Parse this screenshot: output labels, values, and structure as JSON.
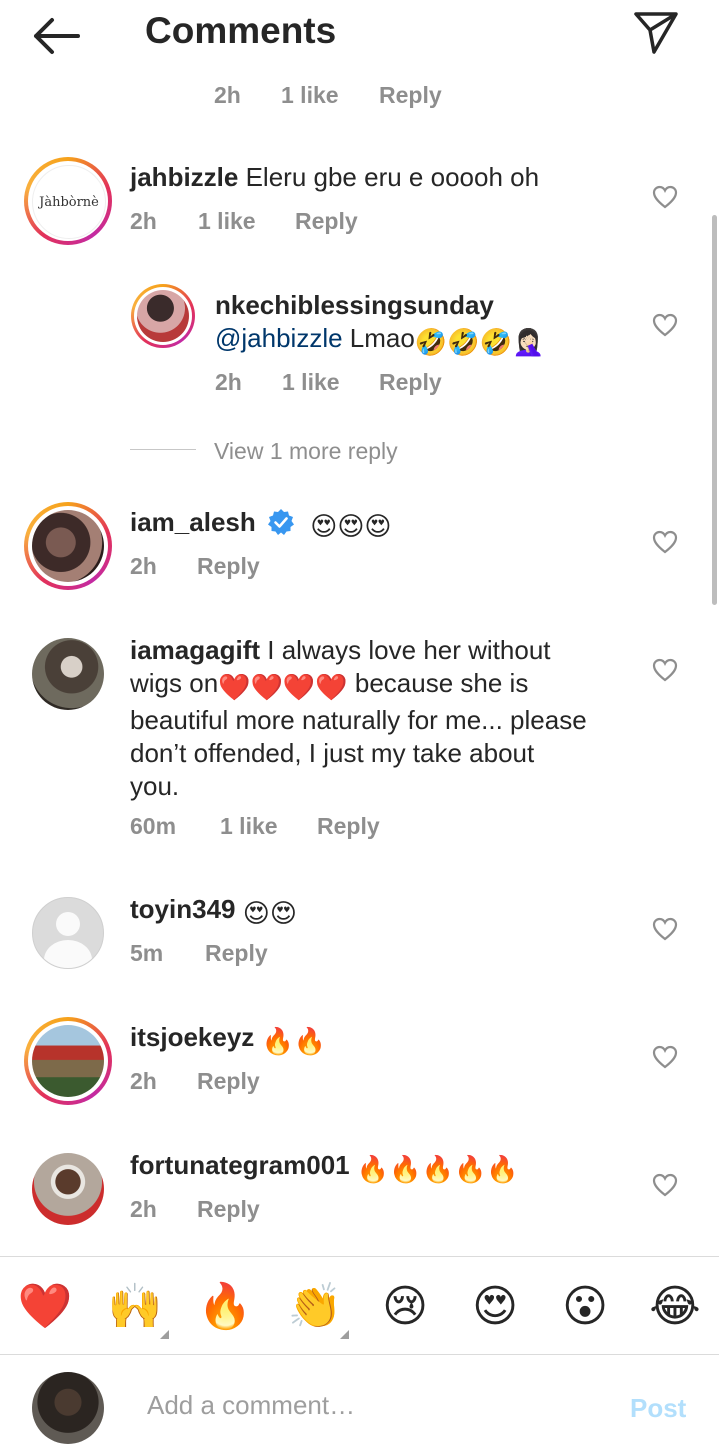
{
  "header": {
    "title": "Comments",
    "back_icon": "arrow-left-icon",
    "share_icon": "paper-plane-icon"
  },
  "top_partial": {
    "time": "2h",
    "likes": "1 like",
    "reply": "Reply"
  },
  "comments": [
    {
      "username": "jahbizzle",
      "text": "Eleru gbe eru e ooooh oh",
      "time": "2h",
      "likes": "1 like",
      "reply": "Reply",
      "avatar_text": "Jàhbòrnè"
    },
    {
      "username": "nkechiblessingsunday",
      "mention": "@jahbizzle",
      "text": "Lmao",
      "emojis": "🤣🤣🤣🤦🏻‍♀️",
      "time": "2h",
      "likes": "1 like",
      "reply": "Reply"
    },
    {
      "username": "iam_alesh",
      "verified": true,
      "emojis": "😍😍😍",
      "time": "2h",
      "reply": "Reply"
    },
    {
      "username": "iamagagift",
      "text_line1": "I always love her without",
      "text_line2a": "wigs on",
      "hearts": "❤️❤️❤️❤️",
      "text_line2b": "because she is",
      "text_line3": "beautiful more naturally for me... please",
      "text_line4": "don’t offended, I just my take about",
      "text_line5": "you.",
      "time": "60m",
      "likes": "1 like",
      "reply": "Reply"
    },
    {
      "username": "toyin349",
      "emojis": "😍😍",
      "time": "5m",
      "reply": "Reply"
    },
    {
      "username": "itsjoekeyz",
      "emojis": "🔥🔥",
      "time": "2h",
      "reply": "Reply"
    },
    {
      "username": "fortunategram001",
      "emojis": "🔥🔥🔥🔥🔥",
      "time": "2h",
      "reply": "Reply"
    }
  ],
  "view_more": "View 1 more reply",
  "reactions": [
    "❤️",
    "🙌",
    "🔥",
    "👏",
    "😢",
    "😍",
    "😮",
    "😂"
  ],
  "input": {
    "placeholder": "Add a comment…",
    "post_label": "Post"
  },
  "colors": {
    "accent_blue": "#0095f6",
    "post_disabled": "#b2dffc",
    "muted": "#8e8e8e",
    "verified": "#3897f0"
  }
}
